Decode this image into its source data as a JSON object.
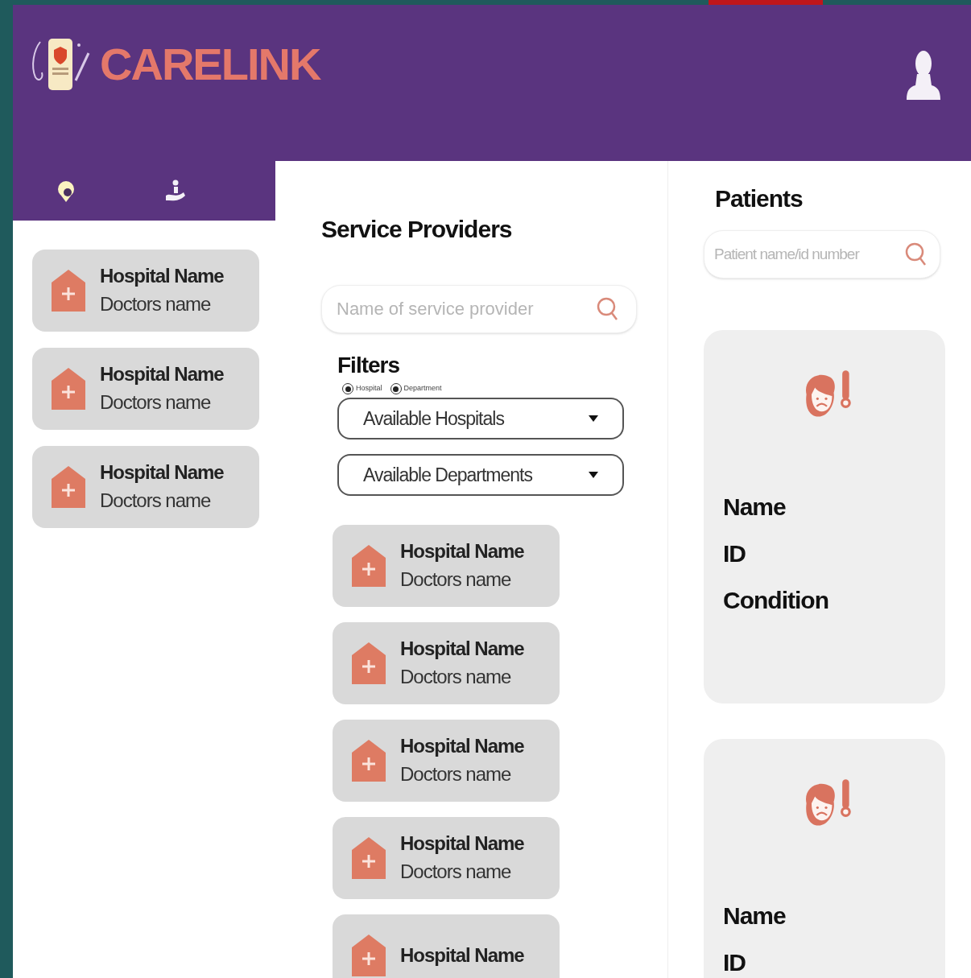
{
  "header": {
    "brand": "CARELINK"
  },
  "sidebar": {
    "tabs": [
      {
        "kind": "support",
        "selected": false
      },
      {
        "kind": "care",
        "selected": false
      }
    ],
    "cards": [
      {
        "title": "Hospital Name",
        "subtitle": "Doctors name"
      },
      {
        "title": "Hospital Name",
        "subtitle": "Doctors name"
      },
      {
        "title": "Hospital Name",
        "subtitle": "Doctors name"
      }
    ]
  },
  "providers": {
    "title": "Service Providers",
    "search": {
      "placeholder": "Name of service provider"
    },
    "filters": {
      "title": "Filters",
      "options": [
        {
          "label": "Hospital",
          "selected": true
        },
        {
          "label": "Department",
          "selected": true
        }
      ],
      "dropdowns": [
        {
          "value": "Available Hospitals"
        },
        {
          "value": "Available Departments"
        }
      ]
    },
    "cards": [
      {
        "title": "Hospital Name",
        "subtitle": "Doctors name"
      },
      {
        "title": "Hospital Name",
        "subtitle": "Doctors name"
      },
      {
        "title": "Hospital Name",
        "subtitle": "Doctors name"
      },
      {
        "title": "Hospital Name",
        "subtitle": "Doctors name"
      },
      {
        "title": "Hospital Name"
      }
    ]
  },
  "patients": {
    "title": "Patients",
    "search": {
      "placeholder": "Patient name/id number"
    },
    "cards": [
      {
        "fields": [
          "Name",
          "ID",
          "Condition"
        ]
      },
      {
        "fields": [
          "Name",
          "ID"
        ]
      }
    ]
  }
}
